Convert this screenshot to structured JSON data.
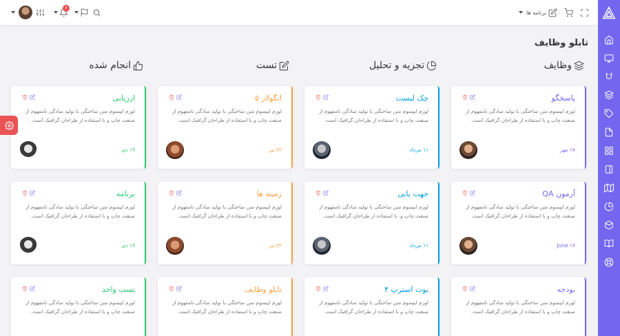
{
  "topbar": {
    "apps_label": "برنامه ها",
    "notification_count": "۶"
  },
  "page_title": "تابلو وظایف",
  "columns": [
    {
      "label": "وظایف",
      "color": "#7367f0",
      "icon": "layers-icon"
    },
    {
      "label": "تجزیه و تحلیل",
      "color": "#00a0e4",
      "icon": "pie-chart-icon"
    },
    {
      "label": "تست",
      "color": "#ff9f43",
      "icon": "edit-icon"
    },
    {
      "label": "انجام شده",
      "color": "#28c76f",
      "icon": "thumbs-up-icon"
    }
  ],
  "cards": {
    "c1": {
      "title": "پاسخگو",
      "desc": "لورم ایپسوم متن ساختگی با تولید سادگی نامفهوم از صنعت چاپ و با استفاده از طراحان گرافیک است.",
      "date": "۱۷ مهر"
    },
    "c2": {
      "title": "چک لیست",
      "desc": "لورم ایپسوم متن ساختگی با تولید سادگی نامفهوم از صنعت چاپ و با استفاده از طراحان گرافیک است.",
      "date": "۱۱ مرداد"
    },
    "c3": {
      "title": "انگولار ۵",
      "desc": "لورم ایپسوم متن ساختگی با تولید سادگی نامفهوم از صنعت چاپ و با استفاده از طراحان گرافیک است.",
      "date": "۲۲ تیر"
    },
    "c4": {
      "title": "ارزیابی",
      "desc": "لورم ایپسوم متن ساختگی با تولید سادگی نامفهوم از صنعت چاپ و با استفاده از طراحان گرافیک است.",
      "date": "۱۹ دی"
    },
    "c5": {
      "title": "آزمون QA",
      "desc": "لورم ایپسوم متن ساختگی با تولید سادگی نامفهوم از صنعت چاپ و با استفاده از طراحان گرافیک است.",
      "date": "June ۱۷"
    },
    "c6": {
      "title": "جهت یابی",
      "desc": "لورم ایپسوم متن ساختگی با تولید سادگی نامفهوم از صنعت چاپ و. با استفاده از طراحان گرافیک است.",
      "date": "۱۱ مرداد"
    },
    "c7": {
      "title": "زمینه ها",
      "desc": "لورم ایپسوم متن ساختگی با تولید سادگی نامفهوم از صنعت چاپ و با استفاده از طراحان گرافیک است.",
      "date": "۲۲ تیر"
    },
    "c8": {
      "title": "برنامه",
      "desc": "لورم ایپسوم متن ساختگی با تولید سادگی نامفهوم از صنعت چاپ و با استفاده از طراحان گرافیک است.",
      "date": "۱۹ دی"
    },
    "c9": {
      "title": "بودجه",
      "desc": "لورم ایپسوم متن ساختگی با تولید سادگی نامفهوم از صنعت چاپ و با استفاده از طراحان گرافیک است."
    },
    "c10": {
      "title": "بوت استرپ ۴",
      "desc": "لورم ایپسوم متن ساختگی با تولید سادگی نامفهوم از صنعت چاپ و با استفاده از طراحان گرافیک است."
    },
    "c11": {
      "title": "تابلو وظایف",
      "desc": "لورم ایپسوم متن ساختگی با تولید سادگی نامفهوم از صنعت چاپ و با استفاده از طراحان گرافیک است."
    },
    "c12": {
      "title": "تست واحد",
      "desc": "لورم ایپسوم متن ساختگی با تولید سادگی نامفهوم از صنعت چاپ و با استفاده از طراحان گرافیک است."
    }
  }
}
